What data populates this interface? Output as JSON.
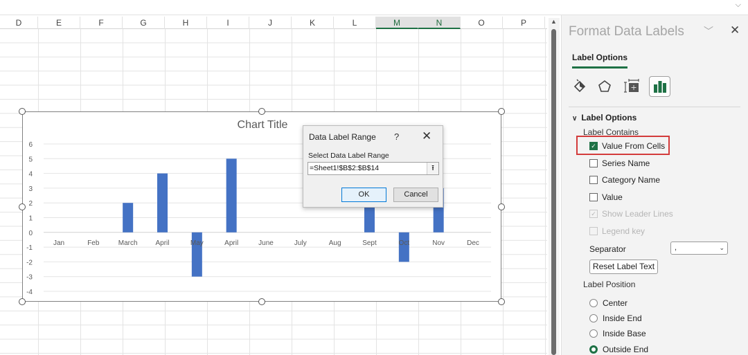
{
  "spreadsheet": {
    "columns": [
      {
        "label": "D",
        "selected": false
      },
      {
        "label": "E",
        "selected": false
      },
      {
        "label": "F",
        "selected": false
      },
      {
        "label": "G",
        "selected": false
      },
      {
        "label": "H",
        "selected": false
      },
      {
        "label": "I",
        "selected": false
      },
      {
        "label": "J",
        "selected": false
      },
      {
        "label": "K",
        "selected": false
      },
      {
        "label": "L",
        "selected": false
      },
      {
        "label": "M",
        "selected": true
      },
      {
        "label": "N",
        "selected": true
      },
      {
        "label": "O",
        "selected": false
      },
      {
        "label": "P",
        "selected": false
      }
    ]
  },
  "chart_data": {
    "type": "bar",
    "title": "Chart Title",
    "categories": [
      "Jan",
      "Feb",
      "March",
      "April",
      "May",
      "April",
      "June",
      "July",
      "Aug",
      "Sept",
      "Oct",
      "Nov",
      "Dec"
    ],
    "values": [
      0,
      0,
      2,
      4,
      -3,
      5,
      0,
      0,
      0,
      3,
      -2,
      3,
      0
    ],
    "ylim": [
      -4,
      6
    ],
    "yticks": [
      "6",
      "5",
      "4",
      "3",
      "2",
      "1",
      "0",
      "-1",
      "-2",
      "-3",
      "-4"
    ],
    "xlabel": "",
    "ylabel": "",
    "grid": true,
    "legend": "none",
    "bar_color": "#4472C4"
  },
  "dialog": {
    "title": "Data Label Range",
    "help": "?",
    "close": "✕",
    "label": "Select Data Label Range",
    "value": "=Sheet1!$B$2:$B$14",
    "picker": "⭱",
    "ok": "OK",
    "cancel": "Cancel"
  },
  "pane": {
    "title": "Format Data Labels",
    "collapse": "﹀",
    "close": "✕",
    "tab": "Label Options",
    "section": "Label Options",
    "label_contains": "Label Contains",
    "checkboxes": [
      {
        "label": "Value From Cells",
        "checked": true,
        "disabled": false
      },
      {
        "label": "Series Name",
        "checked": false,
        "disabled": false
      },
      {
        "label": "Category Name",
        "checked": false,
        "disabled": false
      },
      {
        "label": "Value",
        "checked": false,
        "disabled": false
      },
      {
        "label": "Show Leader Lines",
        "checked": true,
        "disabled": true
      },
      {
        "label": "Legend key",
        "checked": false,
        "disabled": true
      }
    ],
    "separator_label": "Separator",
    "separator_value": ",",
    "reset_label": "Reset Label Text",
    "label_position": "Label Position",
    "positions": [
      {
        "label": "Center",
        "selected": false
      },
      {
        "label": "Inside End",
        "selected": false
      },
      {
        "label": "Inside Base",
        "selected": false
      },
      {
        "label": "Outside End",
        "selected": true
      }
    ],
    "accent": "#1E7145",
    "highlight": "#D33B3B"
  }
}
